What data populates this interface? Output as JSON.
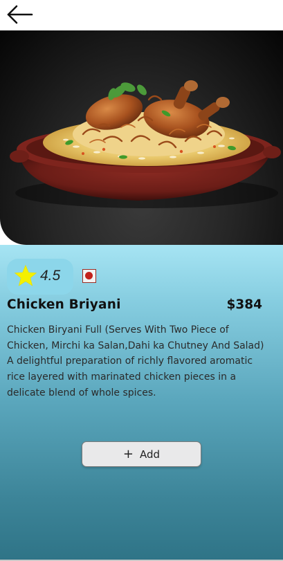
{
  "header": {
    "back_icon": "arrow-left-icon"
  },
  "hero": {
    "image_alt": "Chicken biryani in a clay bowl"
  },
  "product": {
    "rating": "4.5",
    "rating_icon": "star-icon",
    "diet_icon": "non-veg-icon",
    "name": "Chicken Briyani",
    "price": "$384",
    "description": "Chicken Biryani Full (Serves With Two Piece of\nChicken, Mirchi ka Salan,Dahi ka Chutney And Salad)\nA delightful preparation of richly flavored aromatic\nrice layered with marinated chicken pieces in a\ndelicate blend of whole spices."
  },
  "actions": {
    "add_icon": "plus-icon",
    "add_label": "Add"
  },
  "colors": {
    "panel_top": "#a6e4f3",
    "panel_bottom": "#2f7487",
    "star": "#f4f000",
    "non_veg": "#c2221b"
  }
}
